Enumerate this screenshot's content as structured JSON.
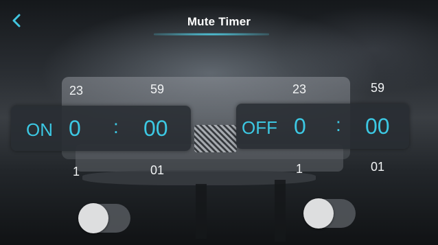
{
  "header": {
    "title": "Mute Timer"
  },
  "on_timer": {
    "label": "ON",
    "hour_above": "23",
    "hour": "0",
    "hour_below": "1",
    "separator": ":",
    "minute_above": "59",
    "minute": "00",
    "minute_below": "01",
    "enabled": false
  },
  "off_timer": {
    "label": "OFF",
    "hour_above": "23",
    "hour": "0",
    "hour_below": "1",
    "separator": ":",
    "minute_above": "59",
    "minute": "00",
    "minute_below": "01",
    "enabled": false
  },
  "colors": {
    "accent": "#3cc8e3",
    "panel": "#2b2f35",
    "text": "#ffffff"
  },
  "icons": {
    "back": "chevron-left-icon"
  }
}
